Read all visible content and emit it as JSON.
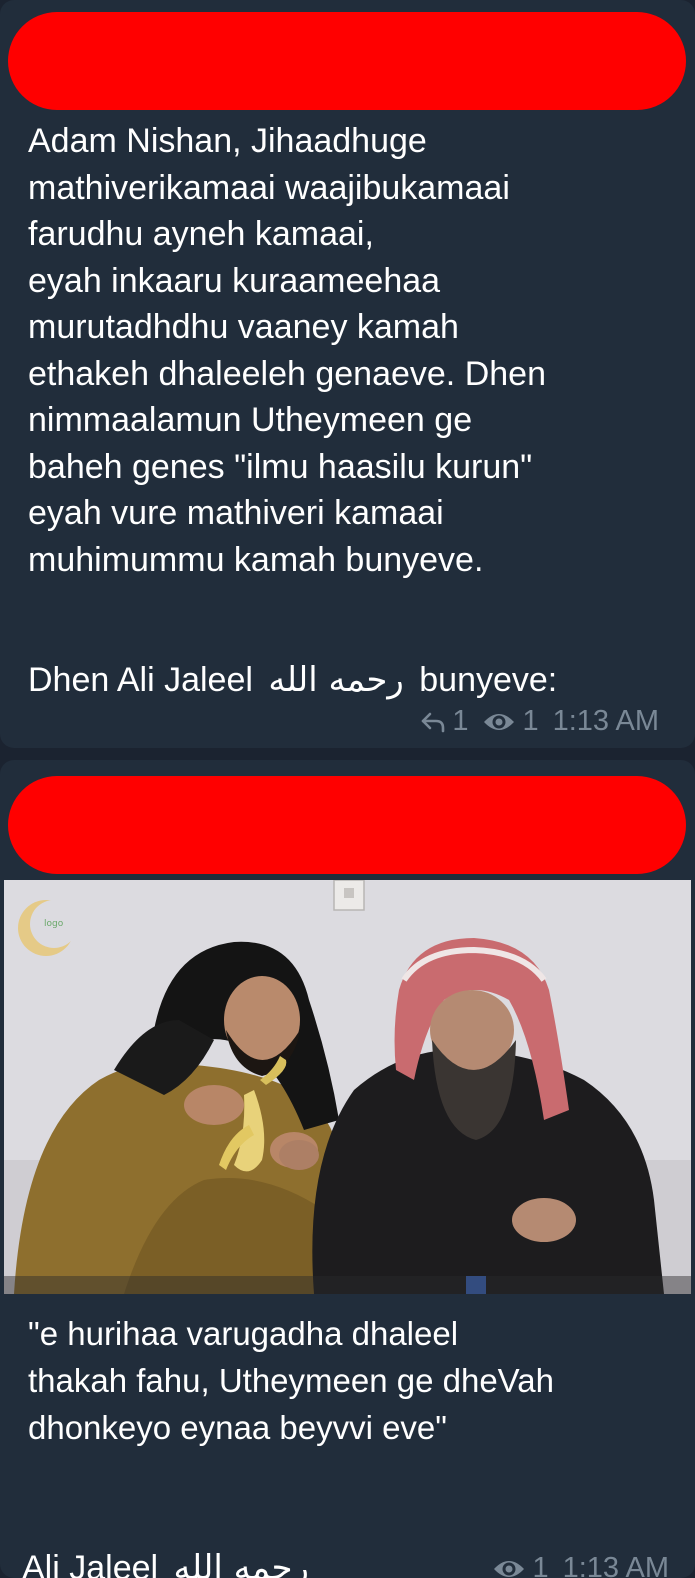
{
  "messages": [
    {
      "text": "Adam Nishan, Jihaadhuge\nmathiverikamaai waajibukamaai\nfarudhu ayneh kamaai,\neyah inkaaru kuraameehaa\nmurutadhdhu vaaney kamah\nethakeh dhaleeleh genaeve. Dhen\nnimmaalamun Utheymeen ge\nbaheh genes \"ilmu haasilu kurun\"\neyah vure mathiveri kamaai\nmuhimummu kamah bunyeve.",
      "signature_prefix": "Dhen Ali Jaleel",
      "signature_arabic": "رحمه الله",
      "signature_suffix": "bunyeve:",
      "replies": "1",
      "views": "1",
      "time": "1:13 AM"
    },
    {
      "caption": "\"e hurihaa varugadha dhaleel\nthakah fahu, Utheymeen ge dheVah\ndhonkeyo eynaa beyvvi eve\"",
      "signature_prefix": "Ali Jaleel",
      "signature_arabic": "رحمه الله",
      "views": "1",
      "time": "1:13 AM"
    }
  ],
  "colors": {
    "background": "#1b2330",
    "bubble": "#212d3b",
    "redaction": "#ff0000",
    "meta_text": "#7a8896"
  },
  "icons": {
    "reply": "reply-arrow-icon",
    "views": "eye-icon"
  }
}
